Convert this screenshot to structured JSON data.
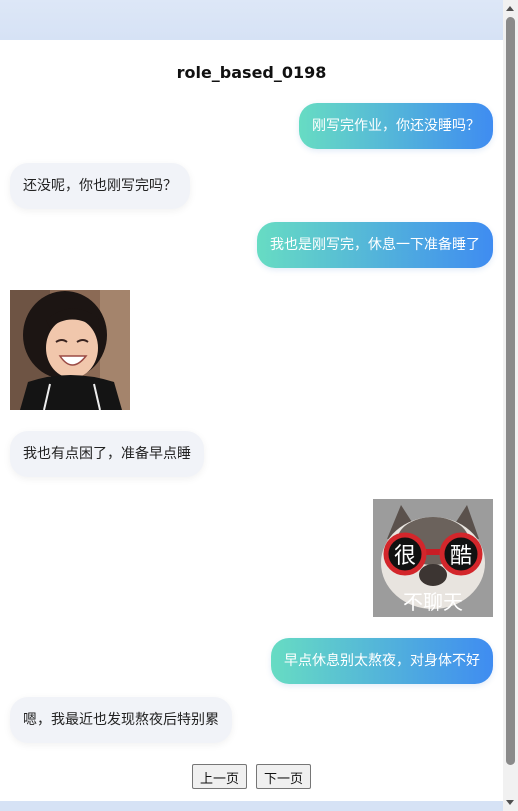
{
  "chat": {
    "title": "role_based_0198",
    "messages": [
      {
        "side": "right",
        "text": "刚写完作业，你还没睡吗？"
      },
      {
        "side": "left",
        "text": "还没呢，你也刚写完吗？"
      },
      {
        "side": "right",
        "text": "我也是刚写完，休息一下准备睡了"
      },
      {
        "side": "left",
        "sticker": "laughing-girl-sticker"
      },
      {
        "side": "left",
        "text": "我也有点困了，准备早点睡"
      },
      {
        "side": "right",
        "sticker": "cool-cat-sticker",
        "sticker_text": {
          "left": "很",
          "right": "酷",
          "bottom": "不聊天"
        }
      },
      {
        "side": "right",
        "text": "早点休息别太熬夜，对身体不好"
      },
      {
        "side": "left",
        "text": "嗯，我最近也发现熬夜后特别累"
      }
    ]
  },
  "pager": {
    "prev_label": "上一页",
    "next_label": "下一页"
  },
  "colors": {
    "bubble_gradient_start": "#67dcc3",
    "bubble_gradient_end": "#3f8cf1",
    "left_bubble_bg": "#f1f3f8"
  }
}
